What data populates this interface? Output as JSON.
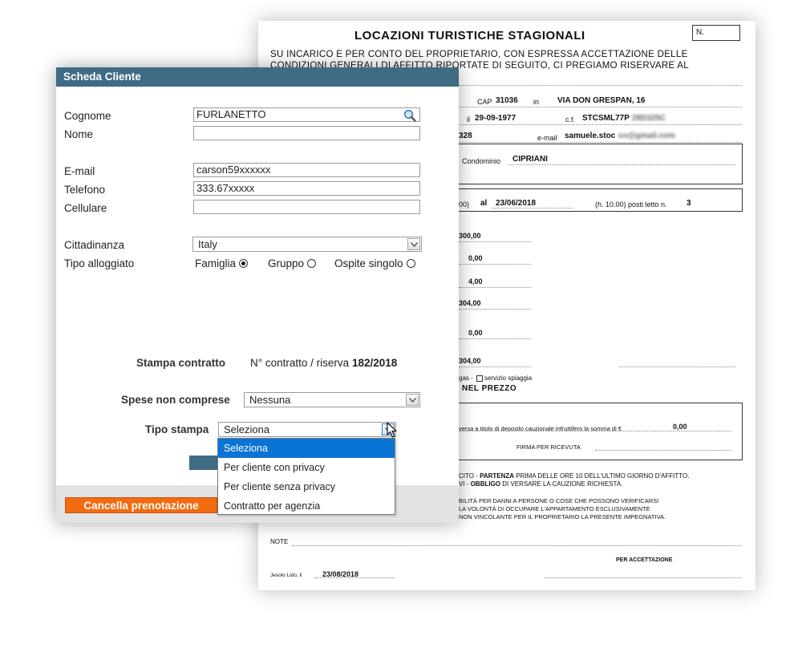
{
  "document": {
    "title": "LOCAZIONI TURISTICHE STAGIONALI",
    "n_label": "N.",
    "intro_line1": "SU INCARICO E PER CONTO DEL PROPRIETARIO, CON ESPRESSA ACCETTAZIONE DELLE",
    "intro_line2": "CONDIZIONI GENERALI DI AFFITTO RIPORTATE DI SEGUITO, CI PREGIAMO RISERVARE AL",
    "cap_label": "CAP",
    "cap_value": "31036",
    "in_label": "in",
    "address": "VIA DON GRESPAN, 16",
    "il_label": "il",
    "birth_date": "29-09-1977",
    "cf_label": "c.f.",
    "cf_value": "STCSML77P",
    "cf_hidden": "29D325C",
    "phone_fragment": "328",
    "email_label": "e-mail",
    "email_value": "samuele.stoc",
    "email_hidden": "co@gmail.com",
    "condominio_label": "Condominio",
    "condominio_value": "CIPRIANI",
    "time_fragment": "00)",
    "al_label": "al",
    "end_date": "23/06/2018",
    "hour_text": "(h. 10.00) posti letto n.",
    "beds": "3",
    "amounts": [
      "300,00",
      "0,00",
      "4,00",
      "304,00",
      "0,00",
      "304,00"
    ],
    "services_text": "gas - ",
    "service_beach": "servizio spiaggia",
    "included_text": "NEL PREZZO",
    "deposit_text": "versa a titolo di deposito cauzionale infruttifero la somma di €",
    "deposit_value": "0,00",
    "signature_text": "FIRMA PER RICEVUTA",
    "terms_line1_a": "CITO  -",
    "terms_line1_b": "PARTENZA",
    "terms_line1_c": "PRIMA DELLE ORE 10 DELL'ULTIMO GIORNO D'AFFITTO.",
    "terms_line2_a": "VI  -",
    "terms_line2_b": "OBBLIGO",
    "terms_line2_c": "DI VERSARE LA CAUZIONE RICHIESTA.",
    "terms_line3": "BILITÀ PER  DANNI A PERSONE  O COSE  CHE POSSONO VERIFICARSI",
    "terms_line4": "LA VOLONTÀ  DI OCCUPARE  L'APPARTAMENTO  ESCLUSIVAMENTE",
    "terms_line5": "NON VINCOLANTE PER IL PROPRIETARIO LA PRESENTE IMPEGNATIVA.",
    "note_label": "NOTE",
    "acceptance_label": "PER ACCETTAZIONE",
    "place_label": "Jesolo Lido, li",
    "place_date": "23/08/2018"
  },
  "dialog": {
    "title": "Scheda Cliente",
    "fields": {
      "cognome": {
        "label": "Cognome",
        "value": "FURLANETTO"
      },
      "nome": {
        "label": "Nome",
        "value": ""
      },
      "email": {
        "label": "E-mail",
        "value": "carson59xxxxxx"
      },
      "telefono": {
        "label": "Telefono",
        "value": "333.67xxxxx"
      },
      "cellulare": {
        "label": "Cellulare",
        "value": ""
      }
    },
    "cittadinanza": {
      "label": "Cittadinanza",
      "value": "Italy"
    },
    "tipo_alloggiato": {
      "label": "Tipo alloggiato",
      "options": [
        {
          "label": "Famiglia",
          "checked": true
        },
        {
          "label": "Gruppo",
          "checked": false
        },
        {
          "label": "Ospite singolo",
          "checked": false
        }
      ]
    },
    "stampa_contratto": {
      "label": "Stampa contratto",
      "number_label": "N° contratto / riserva",
      "number_value": "182/2018"
    },
    "spese": {
      "label": "Spese non comprese",
      "value": "Nessuna"
    },
    "tipo_stampa": {
      "label": "Tipo stampa",
      "value": "Seleziona",
      "options": [
        "Seleziona",
        "Per cliente con privacy",
        "Per cliente senza privacy",
        "Contratto per agenzia"
      ],
      "selected_index": 0
    },
    "cancel_label": "Cancella prenotazione"
  },
  "colors": {
    "header_bg": "#406b84",
    "cancel_bg": "#f26b11",
    "selected_option_bg": "#0a74d6",
    "footer_bg": "#e3e3e3"
  }
}
